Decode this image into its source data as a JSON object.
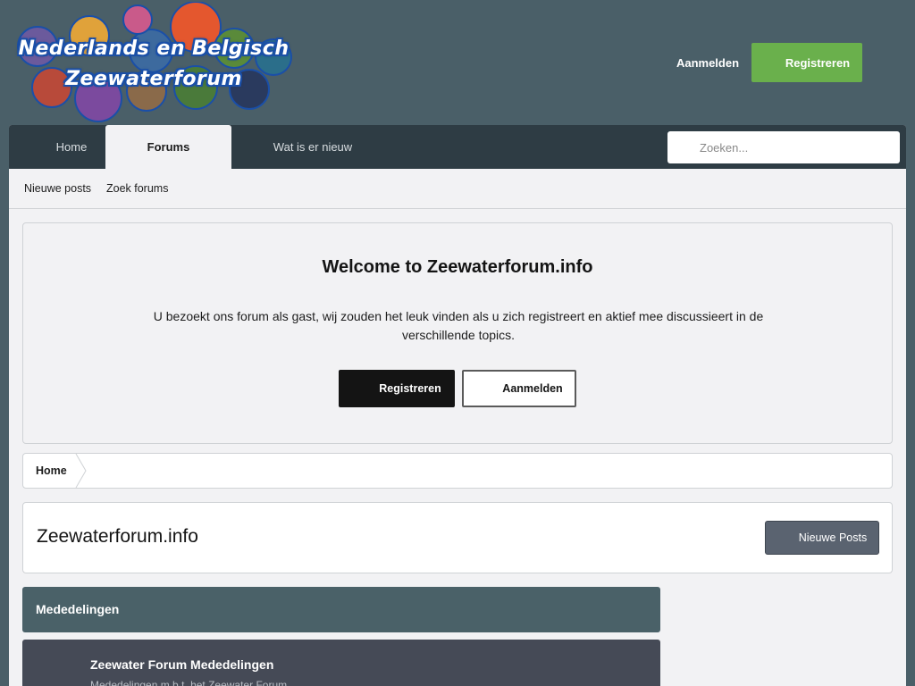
{
  "logo": {
    "line1": "Nederlands en Belgisch",
    "line2": "Zeewaterforum"
  },
  "header": {
    "login_label": "Aanmelden",
    "register_label": "Registreren",
    "register_color": "#6ab04c"
  },
  "nav": {
    "tabs": [
      {
        "label": "Home"
      },
      {
        "label": "Forums"
      },
      {
        "label": "Wat is er nieuw"
      }
    ],
    "search_placeholder": "Zoeken..."
  },
  "subnav": {
    "items": [
      {
        "label": "Nieuwe posts"
      },
      {
        "label": "Zoek forums"
      }
    ]
  },
  "welcome": {
    "title": "Welcome to Zeewaterforum.info",
    "text": "U bezoekt ons forum als gast, wij zouden het leuk vinden als u zich registreert en aktief mee discussieert in de verschillende topics.",
    "register_label": "Registreren",
    "login_label": "Aanmelden"
  },
  "breadcrumb": {
    "items": [
      {
        "label": "Home"
      }
    ]
  },
  "page": {
    "title": "Zeewaterforum.info",
    "new_posts_label": "Nieuwe Posts"
  },
  "categories": [
    {
      "title": "Mededelingen",
      "forums": [
        {
          "title": "Zeewater Forum Mededelingen",
          "description": "Mededelingen m.b.t. het Zeewater Forum"
        }
      ]
    }
  ],
  "colors": {
    "background": "#4a5f68",
    "nav": "#2e3c44",
    "category": "#4a6168",
    "forum_row": "#454a56"
  }
}
